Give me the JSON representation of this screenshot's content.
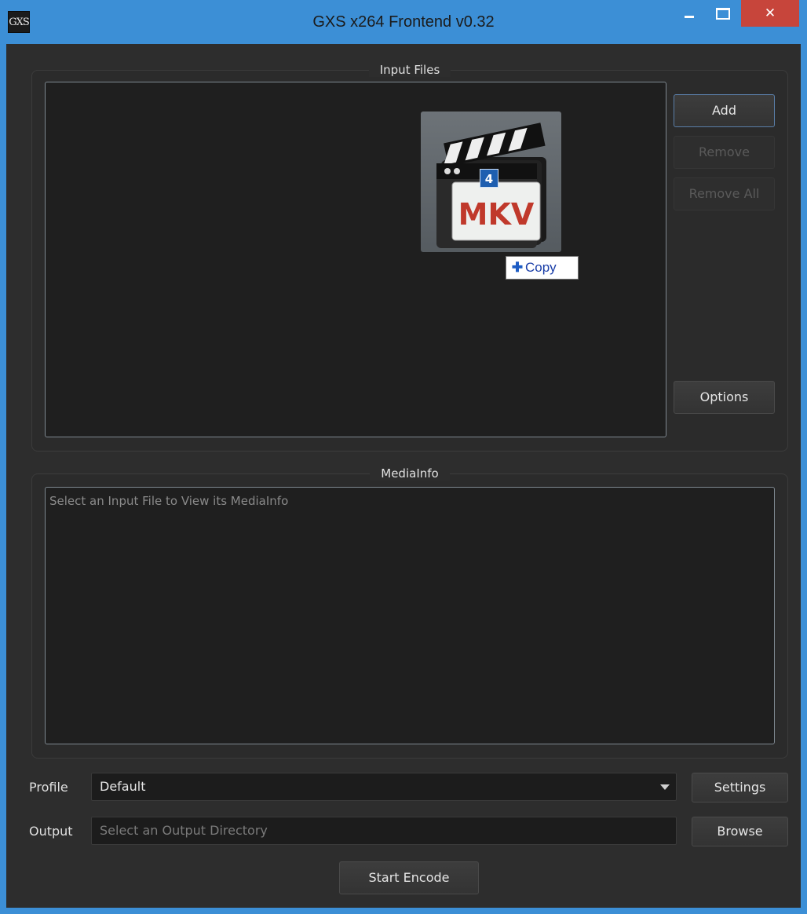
{
  "window": {
    "app_icon": "GXS",
    "title": "GXS x264 Frontend v0.32",
    "controls": {
      "minimize": "minimize-icon",
      "maximize": "maximize-icon",
      "close": "✕"
    }
  },
  "input_files": {
    "label": "Input Files",
    "buttons": {
      "add": "Add",
      "remove": "Remove",
      "remove_all": "Remove All",
      "options": "Options"
    }
  },
  "drag": {
    "icon": "mkv-file-icon",
    "icon_text": "MKV",
    "count": "4",
    "action": "Copy"
  },
  "media_info": {
    "label": "MediaInfo",
    "placeholder": "Select an Input File to View its MediaInfo"
  },
  "profile": {
    "label": "Profile",
    "value": "Default",
    "settings_label": "Settings"
  },
  "output": {
    "label": "Output",
    "placeholder": "Select an Output Directory",
    "browse_label": "Browse"
  },
  "start_encode": "Start Encode",
  "colors": {
    "titlebar": "#3c8fd6",
    "close": "#c7453b",
    "background": "#2d2d2d",
    "list": "#1f1f1f"
  }
}
